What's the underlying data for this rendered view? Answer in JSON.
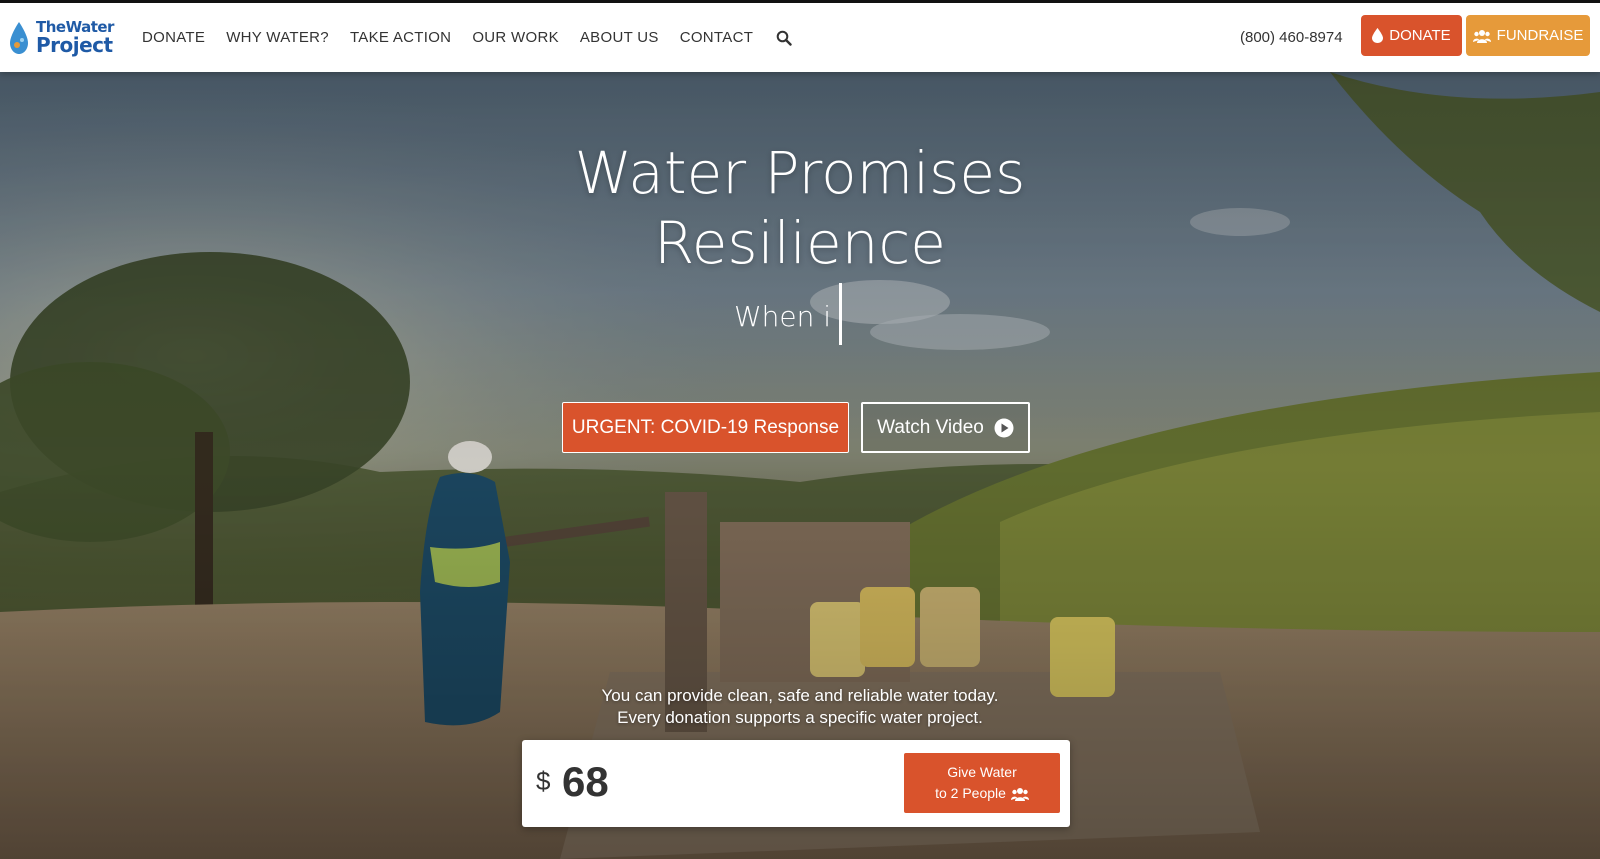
{
  "header": {
    "logo": {
      "line1": "TheWater",
      "line2": "Project"
    },
    "nav": [
      "DONATE",
      "WHY WATER?",
      "TAKE ACTION",
      "OUR WORK",
      "ABOUT US",
      "CONTACT"
    ],
    "phone": "(800) 460-8974",
    "donate_label": "DONATE",
    "fundraise_label": "FUNDRAISE"
  },
  "hero": {
    "title_line1": "Water Promises",
    "title_line2": "Resilience",
    "subtitle": "When i",
    "covid_button": "URGENT: COVID-19 Response",
    "video_button": "Watch Video",
    "cta_line1": "You can provide clean, safe and reliable water today.",
    "cta_line2": "Every donation supports a specific water project."
  },
  "donation": {
    "currency": "$",
    "amount": "68",
    "give_line1": "Give Water",
    "give_line2": "to 2 People"
  },
  "colors": {
    "donate_orange": "#d9532c",
    "fundraise_orange": "#e69a3a",
    "logo_blue": "#1f5aa6"
  }
}
